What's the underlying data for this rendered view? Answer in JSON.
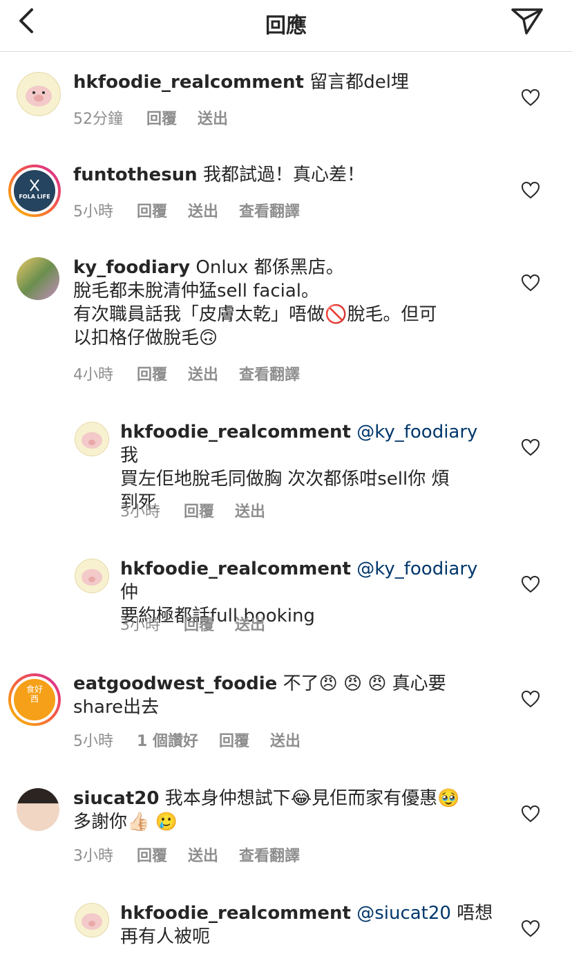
{
  "header": {
    "title": "回應"
  },
  "icons": {
    "back": "chevron-left-icon",
    "send": "paper-plane-icon",
    "like": "heart-outline-icon"
  },
  "colors": {
    "mention": "#00376b",
    "meta": "#8e8e8e",
    "story_ring_start": "#f9c400",
    "story_ring_end": "#d6249f"
  },
  "comments": [
    {
      "user": "hkfoodie_realcomment",
      "text": "留言都del埋",
      "time": "52分鐘",
      "actions": [
        "回覆",
        "送出"
      ]
    },
    {
      "user": "funtothesun",
      "text": "我都試過！真心差！",
      "avatar_text": "FOLA LIFE",
      "time": "5小時",
      "actions": [
        "回覆",
        "送出",
        "查看翻譯"
      ]
    },
    {
      "user": "ky_foodiary",
      "text_lines": [
        "Onlux 都係黑店。",
        "脫毛都未脫清仲猛sell facial。",
        "有次職員話我「皮膚太乾」唔做🚫脫毛。但可",
        "以扣格仔做脫毛🙃"
      ],
      "time": "4小時",
      "actions": [
        "回覆",
        "送出",
        "查看翻譯"
      ]
    },
    {
      "user": "hkfoodie_realcomment",
      "mention": "@ky_foodiary",
      "text_lines": [
        "我",
        "買左佢地脫毛同做胸 次次都係咁sell你 煩",
        "到死"
      ],
      "time": "3小時",
      "actions": [
        "回覆",
        "送出"
      ]
    },
    {
      "user": "hkfoodie_realcomment",
      "mention": "@ky_foodiary",
      "text_lines": [
        "仲",
        "要約極都話full booking"
      ],
      "time": "3小時",
      "actions": [
        "回覆",
        "送出"
      ]
    },
    {
      "user": "eatgoodwest_foodie",
      "text_lines": [
        "不了😠 😠 😠 真心要",
        "share出去"
      ],
      "avatar_text": "食好西",
      "time": "5小時",
      "actions": [
        "1 個讚好",
        "回覆",
        "送出"
      ]
    },
    {
      "user": "siucat20",
      "text_lines": [
        "我本身仲想試下😂見佢而家有優惠🥹",
        "多謝你👍🏻 🥲"
      ],
      "time": "3小時",
      "actions": [
        "回覆",
        "送出",
        "查看翻譯"
      ]
    },
    {
      "user": "hkfoodie_realcomment",
      "mention": "@siucat20",
      "text_lines": [
        "唔想",
        "再有人被呃"
      ]
    }
  ]
}
